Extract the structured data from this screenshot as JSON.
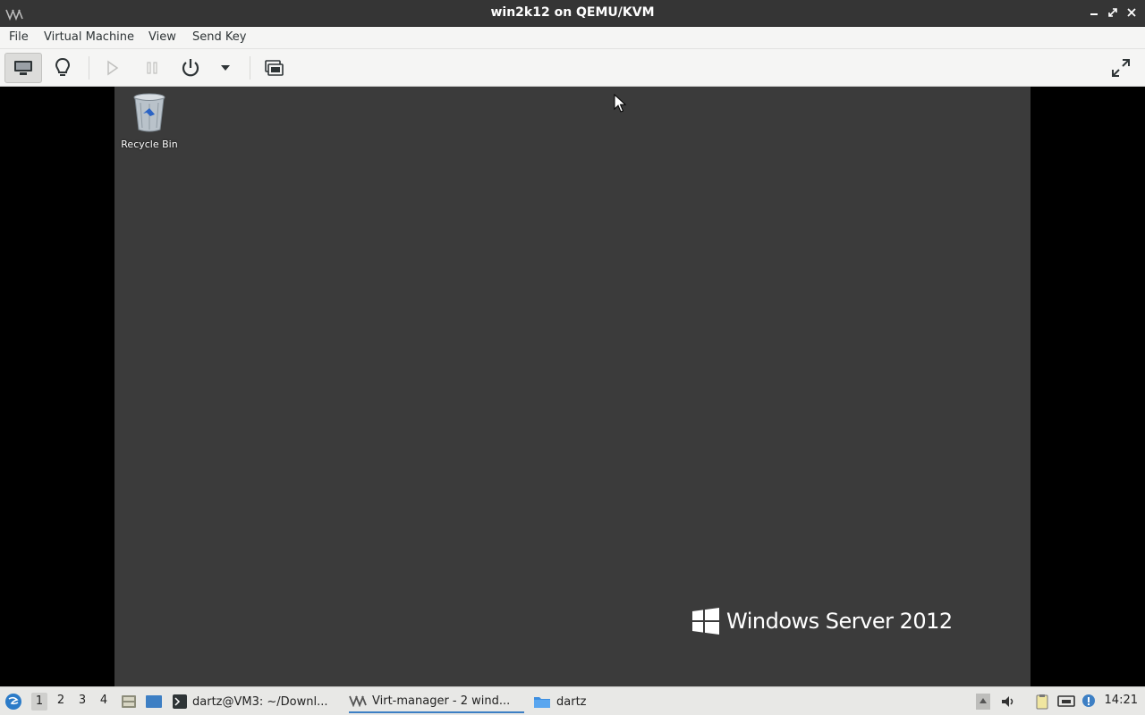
{
  "window": {
    "title": "win2k12 on QEMU/KVM"
  },
  "menubar": {
    "items": [
      "File",
      "Virtual Machine",
      "View",
      "Send Key"
    ]
  },
  "toolbar": {
    "buttons": [
      "console-icon",
      "lightbulb-icon",
      "run-icon",
      "pause-icon",
      "power-icon",
      "dropdown-arrow-icon",
      "snapshot-icon",
      "fullscreen-icon"
    ]
  },
  "guest": {
    "recycle_bin_label": "Recycle Bin",
    "brand_text": "Windows Server 2012"
  },
  "taskbar": {
    "workspaces": [
      "1",
      "2",
      "3",
      "4"
    ],
    "tasks": [
      {
        "label": "dartz@VM3: ~/Downl..."
      },
      {
        "label": "Virt-manager - 2 wind..."
      },
      {
        "label": "dartz"
      }
    ],
    "clock": "14:21"
  },
  "colors": {
    "desktop_bg": "#3b3b3b",
    "titlebar_bg": "#353535",
    "accent": "#3d7fc4"
  }
}
